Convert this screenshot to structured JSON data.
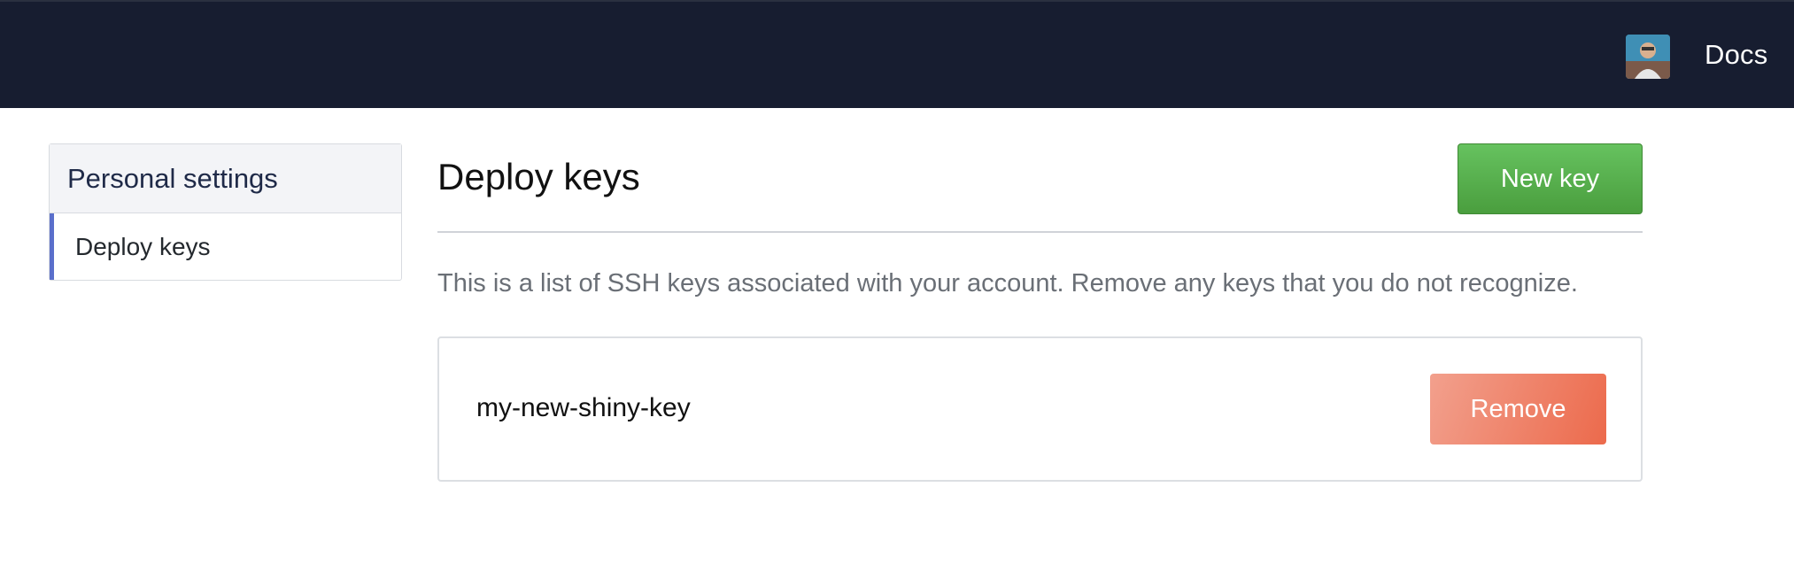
{
  "header": {
    "docs_label": "Docs",
    "avatar_icon": "user-avatar",
    "background_color": "#171d30"
  },
  "sidebar": {
    "title": "Personal settings",
    "items": [
      {
        "label": "Deploy keys",
        "active": true
      }
    ],
    "active_accent": "#5a6fcb"
  },
  "main": {
    "title": "Deploy keys",
    "new_key_label": "New key",
    "description": "This is a list of SSH keys associated with your account. Remove any keys that you do not recognize.",
    "keys": [
      {
        "name": "my-new-shiny-key",
        "remove_label": "Remove"
      }
    ]
  },
  "colors": {
    "primary_button": "#4ea842",
    "danger_button": "#ec6a4c"
  }
}
